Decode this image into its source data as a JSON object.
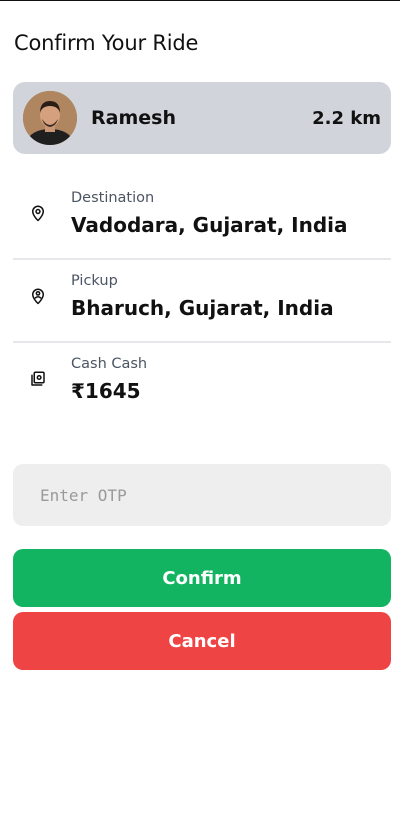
{
  "page": {
    "title": "Confirm Your Ride"
  },
  "driver": {
    "name": "Ramesh",
    "distance": "2.2 km",
    "avatar_icon": "driver-avatar"
  },
  "trip": {
    "destination": {
      "label": "Destination",
      "value": "Vadodara, Gujarat, India",
      "icon": "location-pin-icon"
    },
    "pickup": {
      "label": "Pickup",
      "value": "Bharuch, Gujarat, India",
      "icon": "pickup-pin-icon"
    },
    "fare": {
      "label": "Cash Cash",
      "value": "₹1645",
      "icon": "cash-icon"
    }
  },
  "otp": {
    "placeholder": "Enter OTP",
    "value": ""
  },
  "actions": {
    "confirm_label": "Confirm",
    "cancel_label": "Cancel"
  },
  "colors": {
    "card_bg": "#d1d5db",
    "confirm": "#12b461",
    "cancel": "#ef4444",
    "input_bg": "#eeeeee"
  }
}
